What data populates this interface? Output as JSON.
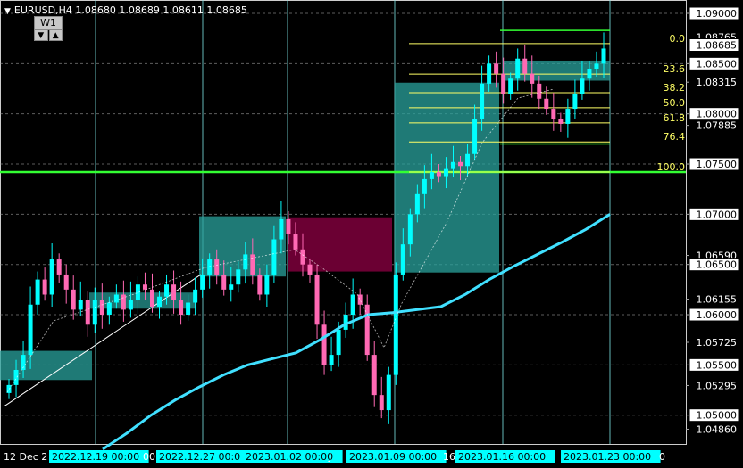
{
  "header": {
    "symbol": "EURUSD,H4",
    "open": "1.08680",
    "high": "1.08689",
    "low": "1.08611",
    "close": "1.08685"
  },
  "controls": {
    "timeframe_button": "W1",
    "arrow_down": "▼",
    "arrow_up": "▲"
  },
  "colors": {
    "background": "#000000",
    "grid": "#7fe5e5",
    "candle_bull": "#00ffff",
    "candle_bear": "#ff69b4",
    "ma": "#40e0ff",
    "fib": "#ffff66",
    "support": "#33ff33",
    "zone_teal": "#2aa39d",
    "zone_magenta": "#6b0033"
  },
  "price_axis": {
    "labels": [
      "1.09000",
      "1.08765",
      "1.08500",
      "1.08315",
      "1.08000",
      "1.07885",
      "1.07500",
      "1.07000",
      "1.06590",
      "1.06500",
      "1.06155",
      "1.06000",
      "1.05725",
      "1.05500",
      "1.05295",
      "1.05000",
      "1.04860"
    ],
    "current_price": "1.08685",
    "boxed": [
      "1.09000",
      "1.08500",
      "1.08000",
      "1.07500",
      "1.07000",
      "1.06500",
      "1.06000",
      "1.05500",
      "1.05000"
    ]
  },
  "time_axis": {
    "labels": [
      {
        "text": "12 Dec 2",
        "boxed": false
      },
      {
        "text": "2022.12.19 00:00",
        "boxed": true
      },
      {
        "text": "2022.12.27 00:0",
        "boxed": true
      },
      {
        "text": "2023.01.02 00:00",
        "boxed": true
      },
      {
        "text": "2023.01.09 00:00",
        "boxed": true
      },
      {
        "text": "2023.01.16 00:00",
        "boxed": true
      },
      {
        "text": "2023.01.23 00:00",
        "boxed": true
      }
    ],
    "fragments": [
      "00",
      "J",
      "16",
      "0"
    ]
  },
  "fibonacci": {
    "levels": [
      {
        "label": "0.0",
        "price": 1.087
      },
      {
        "label": "23.6",
        "price": 1.08395
      },
      {
        "label": "38.2",
        "price": 1.0821
      },
      {
        "label": "50.0",
        "price": 1.0806
      },
      {
        "label": "61.8",
        "price": 1.0791
      },
      {
        "label": "76.4",
        "price": 1.0772
      },
      {
        "label": "100.0",
        "price": 1.0742
      }
    ]
  },
  "chart_data": {
    "type": "candlestick",
    "symbol": "EURUSD",
    "timeframe": "H4",
    "ylim": [
      1.0466,
      1.0908
    ],
    "support_level": 1.0742,
    "top_box_line": 1.0883,
    "bottom_fib_box_line": 1.077,
    "time_labels": [
      "2022.12.19 00:00",
      "2022.12.27 00:00",
      "2023.01.02 00:00",
      "2023.01.09 00:00",
      "2023.01.16 00:00",
      "2023.01.23 00:00"
    ],
    "closes": [
      1.053,
      1.0545,
      1.056,
      1.061,
      1.0635,
      1.062,
      1.0655,
      1.064,
      1.0625,
      1.0605,
      1.0615,
      1.059,
      1.0615,
      1.06,
      1.0612,
      1.062,
      1.0605,
      1.0615,
      1.063,
      1.0625,
      1.0608,
      1.0618,
      1.063,
      1.0615,
      1.06,
      1.0612,
      1.0625,
      1.064,
      1.0655,
      1.064,
      1.0625,
      1.063,
      1.0645,
      1.066,
      1.064,
      1.062,
      1.064,
      1.0675,
      1.0695,
      1.068,
      1.0665,
      1.065,
      1.064,
      1.059,
      1.055,
      1.056,
      1.0585,
      1.06,
      1.062,
      1.061,
      1.056,
      1.052,
      1.0505,
      1.054,
      1.064,
      1.067,
      1.07,
      1.072,
      1.0735,
      1.0742,
      1.0738,
      1.0745,
      1.0752,
      1.0748,
      1.076,
      1.0795,
      1.083,
      1.085,
      1.084,
      1.082,
      1.0835,
      1.0855,
      1.084,
      1.083,
      1.0815,
      1.0805,
      1.0795,
      1.079,
      1.0805,
      1.082,
      1.0835,
      1.0845,
      1.085,
      1.0865
    ],
    "moving_average": [
      1.0466,
      1.0482,
      1.05,
      1.0515,
      1.0528,
      1.054,
      1.055,
      1.0556,
      1.0562,
      1.0575,
      1.059,
      1.06,
      1.0602,
      1.0605,
      1.0608,
      1.062,
      1.0635,
      1.0648,
      1.066,
      1.0672,
      1.0685,
      1.07
    ]
  }
}
